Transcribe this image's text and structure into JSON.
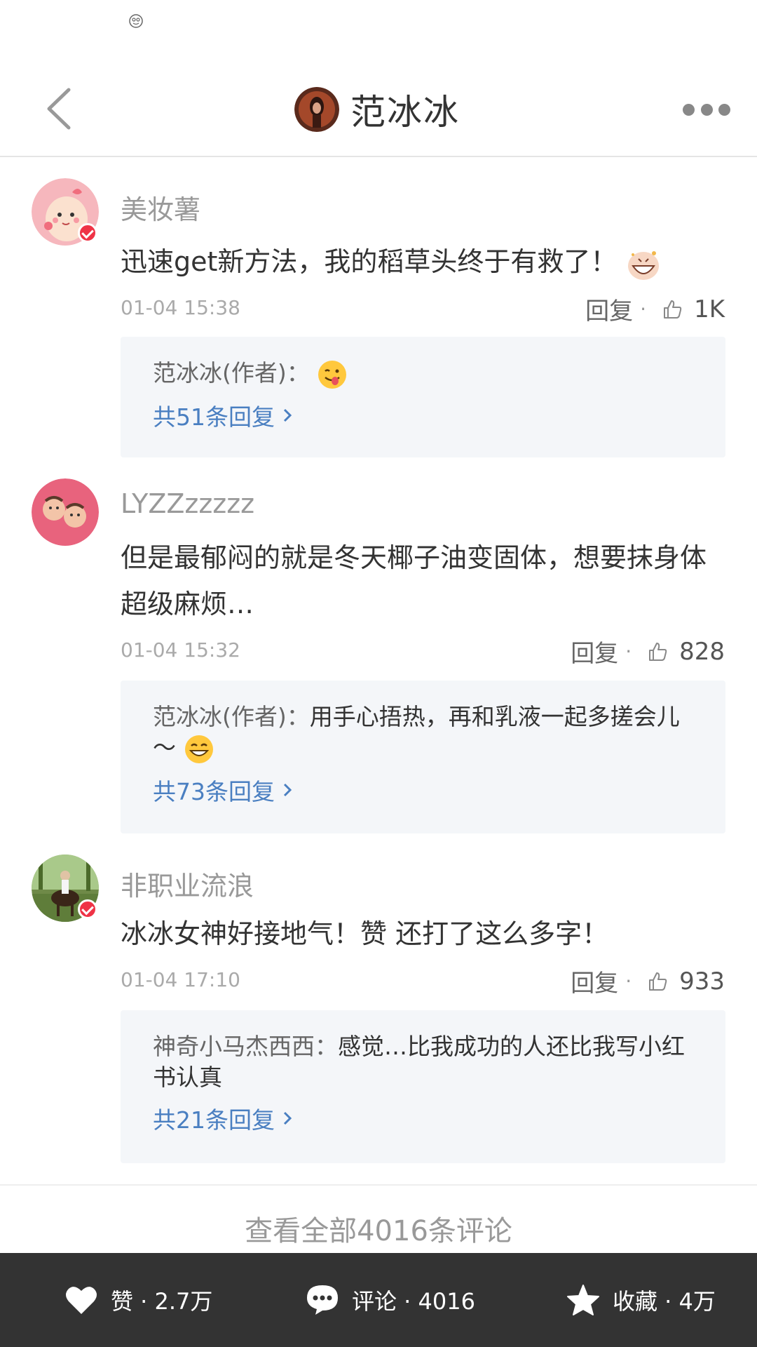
{
  "header": {
    "title": "范冰冰"
  },
  "comments": [
    {
      "username": "美妆薯",
      "text": "迅速get新方法，我的稻草头终于有救了！",
      "time": "01-04 15:38",
      "reply_label": "回复",
      "likes": "1K",
      "verified": true,
      "reply": {
        "author": "范冰冰(作者)：",
        "text": "",
        "more": "共51条回复"
      }
    },
    {
      "username": "LYZZzzzzz",
      "text": "但是最郁闷的就是冬天椰子油变固体，想要抹身体超级麻烦…",
      "time": "01-04 15:32",
      "reply_label": "回复",
      "likes": "828",
      "verified": false,
      "reply": {
        "author": "范冰冰(作者)：",
        "text": "用手心捂热，再和乳液一起多搓会儿～",
        "more": "共73条回复"
      }
    },
    {
      "username": "非职业流浪",
      "text": "冰冰女神好接地气！赞 还打了这么多字！",
      "time": "01-04 17:10",
      "reply_label": "回复",
      "likes": "933",
      "verified": true,
      "reply": {
        "author": "神奇小马杰西西：",
        "text": "感觉…比我成功的人还比我写小红书认真",
        "more": "共21条回复"
      }
    }
  ],
  "view_all": "查看全部4016条评论",
  "bottom_bar": {
    "like": "赞 · 2.7万",
    "comment": "评论 · 4016",
    "collect": "收藏 · 4万"
  },
  "icons": {
    "back": "chevron-left-icon",
    "more": "more-dots-icon",
    "like": "thumb-up-icon",
    "heart": "heart-icon",
    "comment": "chat-bubble-icon",
    "star": "star-icon"
  },
  "colors": {
    "link": "#4a7fc1",
    "bar": "#333333",
    "verified": "#ef3346"
  }
}
